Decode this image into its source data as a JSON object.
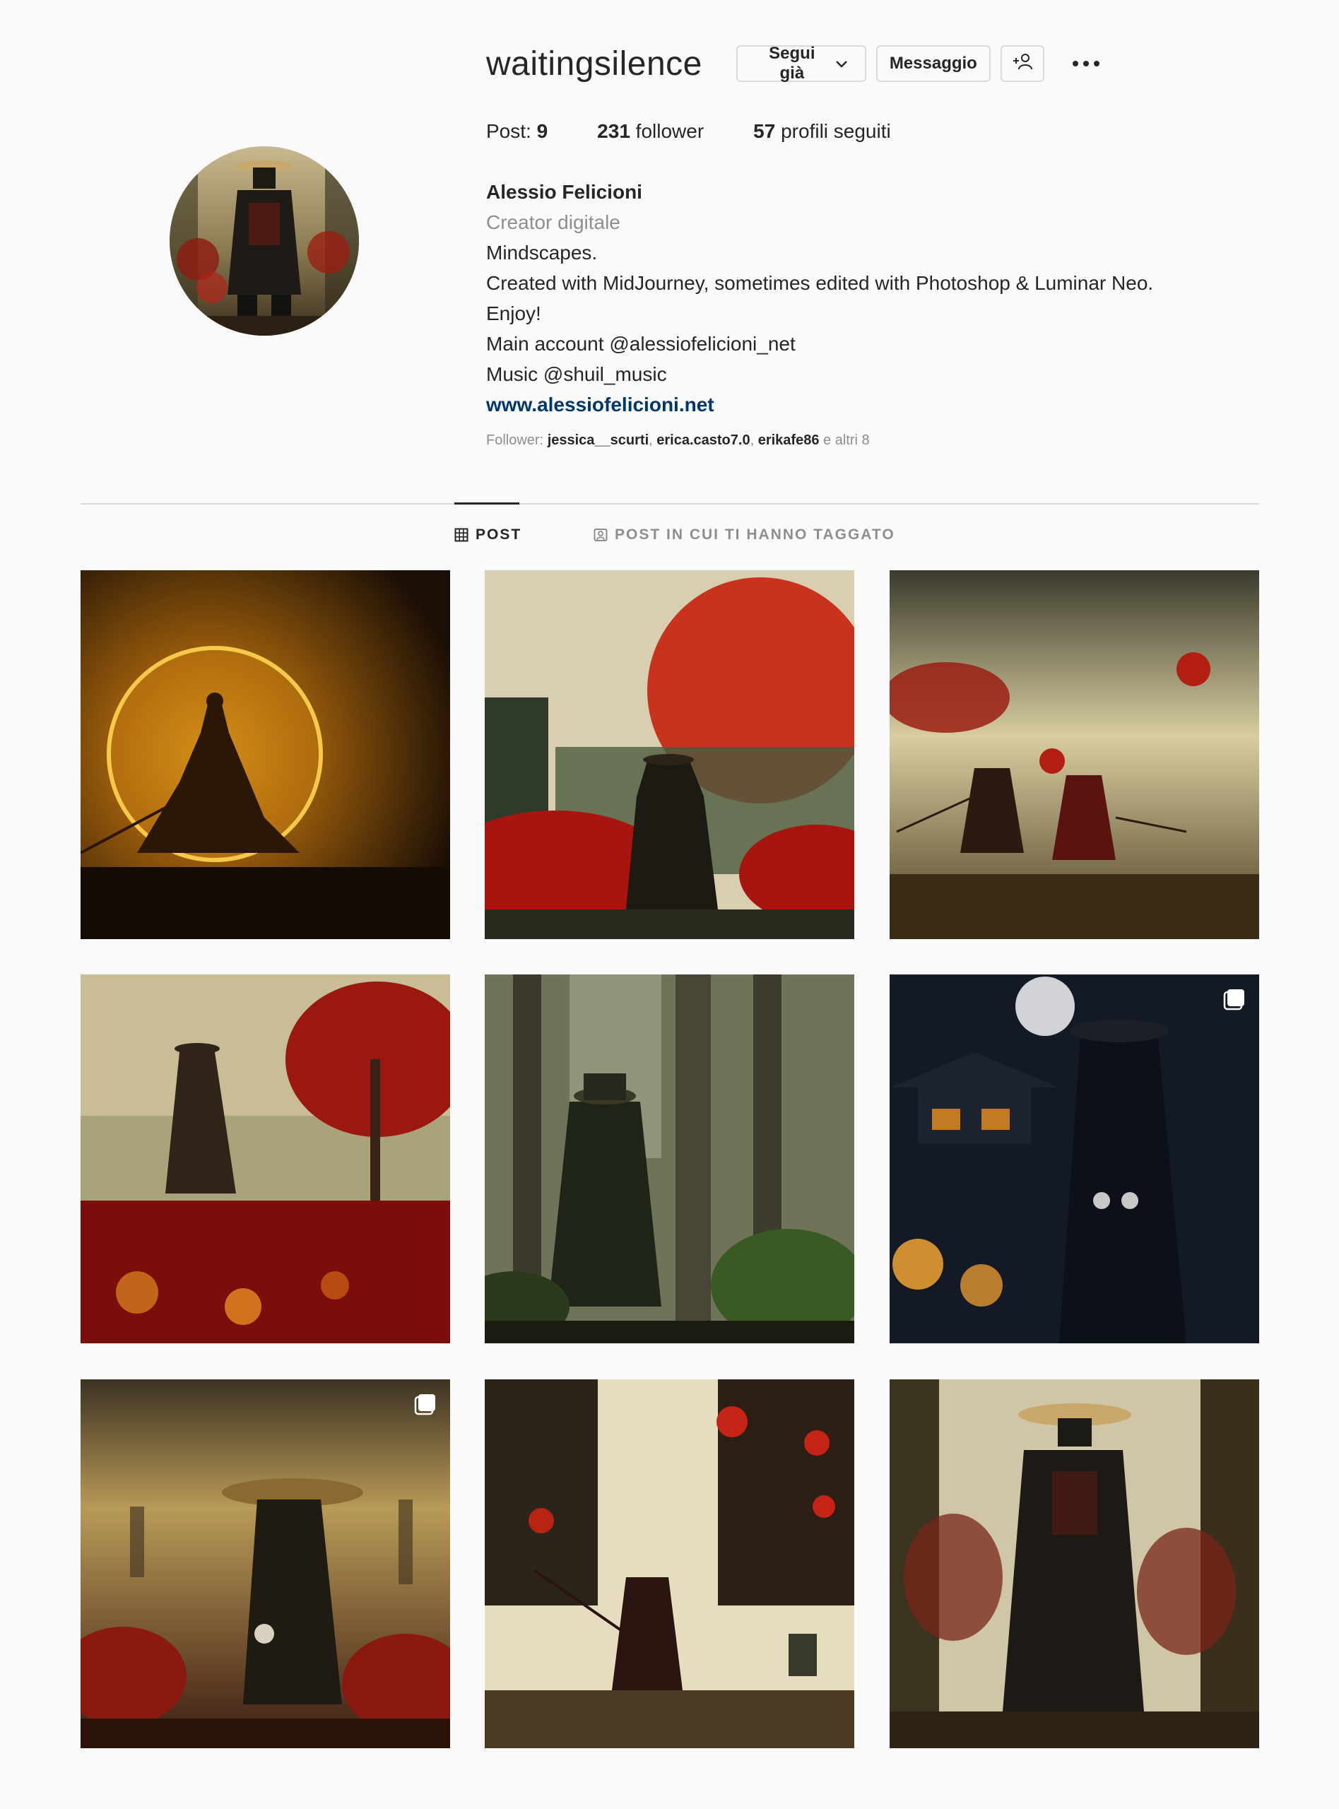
{
  "profile": {
    "username": "waitingsilence",
    "follow_button": "Segui già",
    "message_button": "Messaggio",
    "suggest_icon": "add-person-icon",
    "more_icon": "more-options-icon"
  },
  "stats": {
    "posts_label": "Post:",
    "posts_count": "9",
    "followers_count": "231",
    "followers_label": "follower",
    "following_count": "57",
    "following_label": "profili seguiti"
  },
  "bio": {
    "full_name": "Alessio Felicioni",
    "category": "Creator digitale",
    "lines": [
      "Mindscapes.",
      "Created with MidJourney, sometimes edited with Photoshop & Luminar Neo.",
      "Enjoy!",
      "Main account @alessiofelicioni_net",
      "Music @shuil_music"
    ],
    "website": "www.alessiofelicioni.net"
  },
  "followed_by": {
    "label": "Follower:",
    "users": [
      "jessica__scurti",
      "erica.casto7.0",
      "erikafe86"
    ],
    "separator": ", ",
    "others": "e altri 8"
  },
  "tabs": [
    {
      "label": "POST",
      "icon": "grid-icon",
      "active": true
    },
    {
      "label": "POST IN CUI TI HANNO TAGGATO",
      "icon": "tag-icon",
      "active": false
    }
  ],
  "colors": {
    "text": "#262626",
    "secondary": "#8e8e8e",
    "link": "#00376b",
    "border": "#dbdbdb",
    "background": "#fafafa"
  },
  "posts": [
    {
      "description": "samurai-silhouette-golden-moon",
      "multi": false
    },
    {
      "description": "samurai-red-sun-red-flowers",
      "multi": false
    },
    {
      "description": "two-samurai-red-blossoms",
      "multi": false
    },
    {
      "description": "samurai-red-tree-flower-field",
      "multi": false
    },
    {
      "description": "samurai-forest",
      "multi": false
    },
    {
      "description": "samurai-night-lanterns",
      "multi": true
    },
    {
      "description": "samurai-straw-hat-temples",
      "multi": true
    },
    {
      "description": "samurai-red-lanterns-city",
      "multi": false
    },
    {
      "description": "samurai-straw-hat-red-forest",
      "multi": false
    }
  ]
}
